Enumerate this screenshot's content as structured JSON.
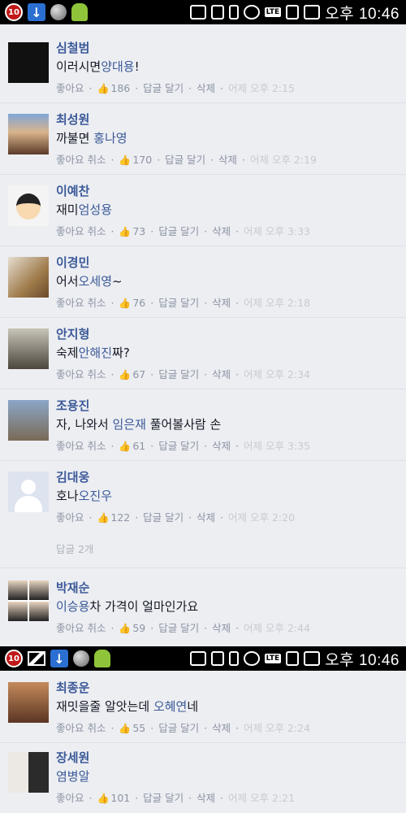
{
  "status_bar": {
    "badge": "10",
    "time": "오후 10:46",
    "lte": "LTE"
  },
  "comments": [
    {
      "name": "심철범",
      "text_pre": "이러시면",
      "tag": "양대용",
      "text_post": "!",
      "like": "좋아요",
      "count": "186",
      "reply": "답글 달기",
      "delete": "삭제",
      "time": "어제 오후 2:15"
    },
    {
      "name": "최성원",
      "text_pre": "까불면 ",
      "tag": "홍나영",
      "text_post": "",
      "like": "좋아요 취소",
      "count": "170",
      "reply": "답글 달기",
      "delete": "삭제",
      "time": "어제 오후 2:19"
    },
    {
      "name": "이예찬",
      "text_pre": "재미",
      "tag": "엄성용",
      "text_post": "",
      "like": "좋아요 취소",
      "count": "73",
      "reply": "답글 달기",
      "delete": "삭제",
      "time": "어제 오후 3:33"
    },
    {
      "name": "이경민",
      "text_pre": "어서",
      "tag": "오세영",
      "text_post": "~",
      "like": "좋아요 취소",
      "count": "76",
      "reply": "답글 달기",
      "delete": "삭제",
      "time": "어제 오후 2:18"
    },
    {
      "name": "안지형",
      "text_pre": "숙제",
      "tag": "안해진",
      "text_post": "짜?",
      "like": "좋아요 취소",
      "count": "67",
      "reply": "답글 달기",
      "delete": "삭제",
      "time": "어제 오후 2:34"
    },
    {
      "name": "조용진",
      "text_pre": "자, 나와서 ",
      "tag": "임은재",
      "text_post": " 풀어볼사람 손",
      "like": "좋아요 취소",
      "count": "61",
      "reply": "답글 달기",
      "delete": "삭제",
      "time": "어제 오후 3:35"
    },
    {
      "name": "김대웅",
      "text_pre": "호나",
      "tag": "오진우",
      "text_post": "",
      "like": "좋아요",
      "count": "122",
      "reply": "답글 달기",
      "delete": "삭제",
      "time": "어제 오후 2:20",
      "replies": "답글 2개"
    },
    {
      "name": "박재순",
      "text_pre": "",
      "tag": "이승용",
      "text_post": "차 가격이 얼마인가요",
      "like": "좋아요 취소",
      "count": "59",
      "reply": "답글 달기",
      "delete": "삭제",
      "time": "어제 오후 2:44"
    },
    {
      "name": "최종운",
      "text_pre": "재밋을줄 알앗는데 ",
      "tag": "오혜연",
      "text_post": "네",
      "like": "좋아요 취소",
      "count": "55",
      "reply": "답글 달기",
      "delete": "삭제",
      "time": "어제 오후 2:24"
    },
    {
      "name": "장세원",
      "text_pre": "",
      "tag": "염병알",
      "text_post": "",
      "like": "좋아요",
      "count": "101",
      "reply": "답글 달기",
      "delete": "삭제",
      "time": "어제 오후 2:21"
    }
  ]
}
